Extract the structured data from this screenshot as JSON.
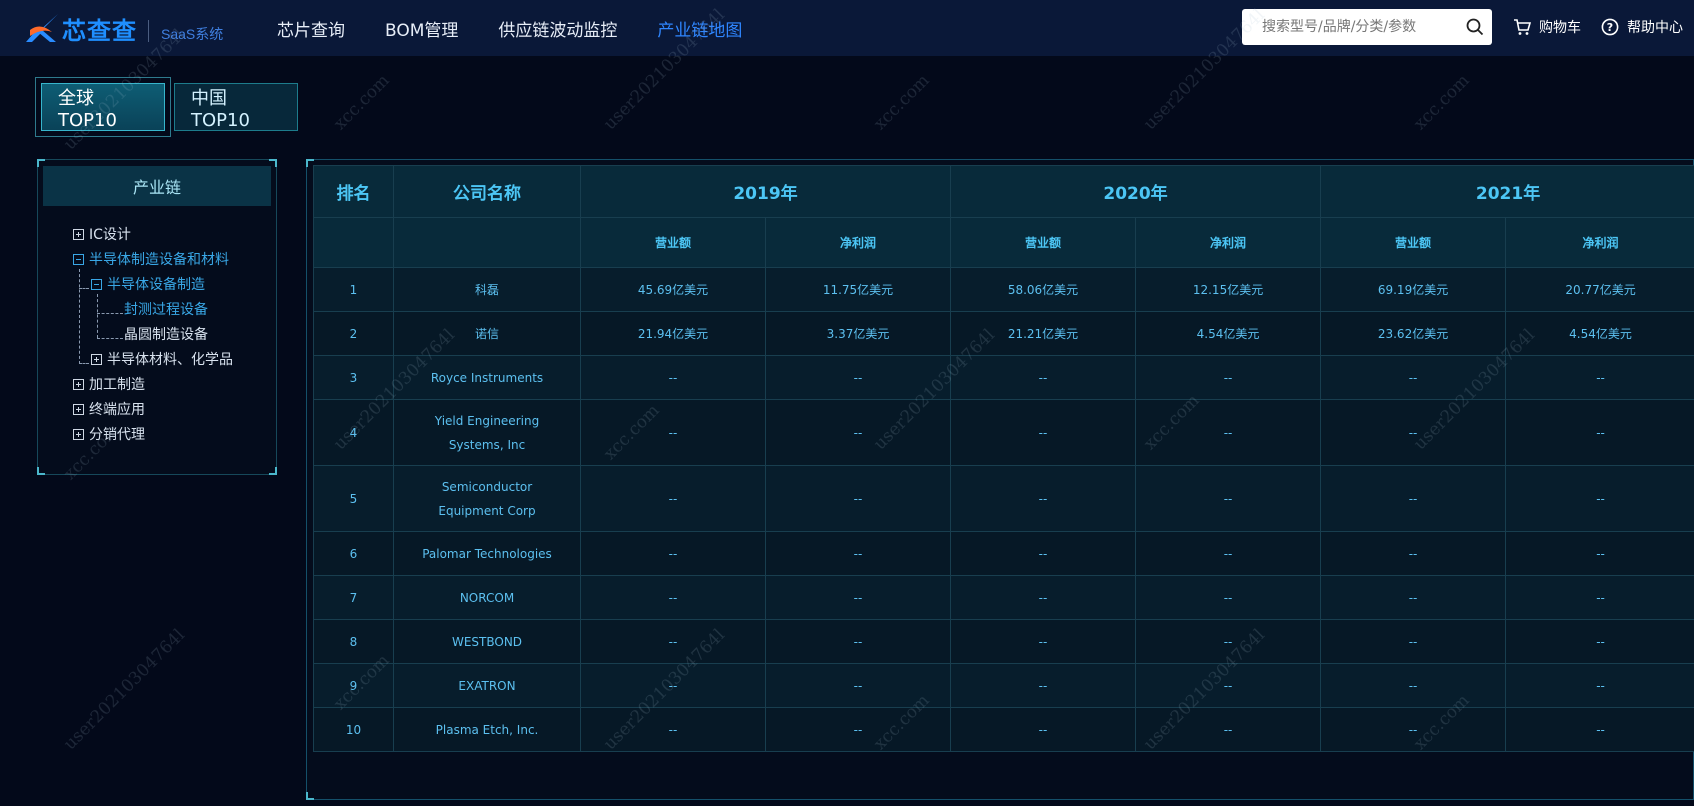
{
  "brand": {
    "logo_text": "芯查查",
    "saas_label": "SaaS系统",
    "accent": "#2f86ff"
  },
  "nav": {
    "items": [
      {
        "label": "芯片查询",
        "active": false
      },
      {
        "label": "BOM管理",
        "active": false
      },
      {
        "label": "供应链波动监控",
        "active": false
      },
      {
        "label": "产业链地图",
        "active": true
      }
    ]
  },
  "search": {
    "placeholder": "搜索型号/品牌/分类/参数",
    "value": "",
    "icon": "search-icon"
  },
  "header_actions": {
    "cart_label": "购物车",
    "cart_icon": "cart-icon",
    "help_label": "帮助中心",
    "help_icon": "help-icon"
  },
  "tabs": [
    {
      "label": "全球TOP10",
      "active": true
    },
    {
      "label": "中国TOP10",
      "active": false
    }
  ],
  "tree": {
    "title": "产业链",
    "items": [
      {
        "label": "IC设计",
        "state": "collapsed"
      },
      {
        "label": "半导体制造设备和材料",
        "state": "expanded"
      },
      {
        "label": "半导体设备制造",
        "state": "expanded"
      },
      {
        "label": "封测过程设备",
        "state": "leaf-selected"
      },
      {
        "label": "晶圆制造设备",
        "state": "leaf"
      },
      {
        "label": "半导体材料、化学品",
        "state": "collapsed"
      },
      {
        "label": "加工制造",
        "state": "collapsed"
      },
      {
        "label": "终端应用",
        "state": "collapsed"
      },
      {
        "label": "分销代理",
        "state": "collapsed"
      }
    ]
  },
  "table": {
    "headers": {
      "rank": "排名",
      "company": "公司名称",
      "years": [
        "2019年",
        "2020年",
        "2021年"
      ],
      "revenue": "营业额",
      "profit": "净利润"
    },
    "rows": [
      {
        "rank": "1",
        "name": "科磊",
        "v": [
          "45.69亿美元",
          "11.75亿美元",
          "58.06亿美元",
          "12.15亿美元",
          "69.19亿美元",
          "20.77亿美元"
        ]
      },
      {
        "rank": "2",
        "name": "诺信",
        "v": [
          "21.94亿美元",
          "3.37亿美元",
          "21.21亿美元",
          "4.54亿美元",
          "23.62亿美元",
          "4.54亿美元"
        ]
      },
      {
        "rank": "3",
        "name": "Royce Instruments",
        "v": [
          "--",
          "--",
          "--",
          "--",
          "--",
          "--"
        ]
      },
      {
        "rank": "4",
        "name": "Yield Engineering Systems, Inc",
        "v": [
          "--",
          "--",
          "--",
          "--",
          "--",
          "--"
        ]
      },
      {
        "rank": "5",
        "name": "Semiconductor Equipment Corp",
        "v": [
          "--",
          "--",
          "--",
          "--",
          "--",
          "--"
        ]
      },
      {
        "rank": "6",
        "name": "Palomar Technologies",
        "v": [
          "--",
          "--",
          "--",
          "--",
          "--",
          "--"
        ]
      },
      {
        "rank": "7",
        "name": "NORCOM",
        "v": [
          "--",
          "--",
          "--",
          "--",
          "--",
          "--"
        ]
      },
      {
        "rank": "8",
        "name": "WESTBOND",
        "v": [
          "--",
          "--",
          "--",
          "--",
          "--",
          "--"
        ]
      },
      {
        "rank": "9",
        "name": "EXATRON",
        "v": [
          "--",
          "--",
          "--",
          "--",
          "--",
          "--"
        ]
      },
      {
        "rank": "10",
        "name": "Plasma Etch, Inc.",
        "v": [
          "--",
          "--",
          "--",
          "--",
          "--",
          "--"
        ]
      }
    ]
  },
  "watermark": {
    "user": "user20210304764l",
    "site": "xcc.com"
  }
}
